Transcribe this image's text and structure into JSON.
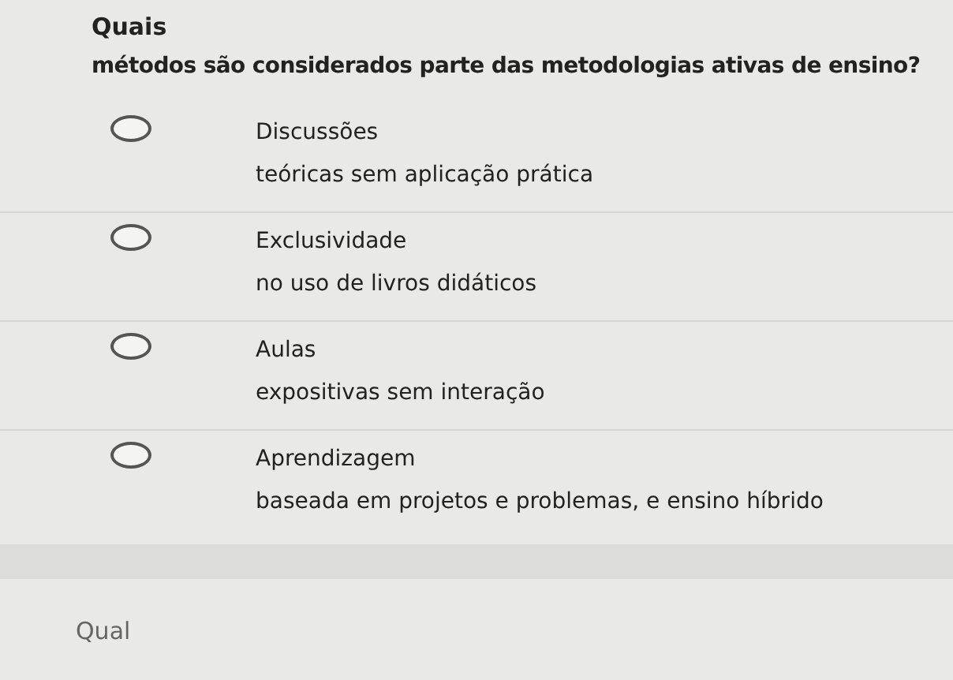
{
  "question": {
    "title": "Quais",
    "text": "métodos são considerados parte das metodologias ativas de ensino?"
  },
  "options": [
    {
      "label": "Discussões",
      "detail": "teóricas sem aplicação prática",
      "selected": false
    },
    {
      "label": "Exclusividade",
      "detail": "no uso de livros didáticos",
      "selected": false
    },
    {
      "label": "Aulas",
      "detail": "expositivas sem interação",
      "selected": false
    },
    {
      "label": "Aprendizagem",
      "detail": "baseada em projetos e problemas, e ensino híbrido",
      "selected": false
    }
  ],
  "next_question": {
    "title": "Qual"
  }
}
